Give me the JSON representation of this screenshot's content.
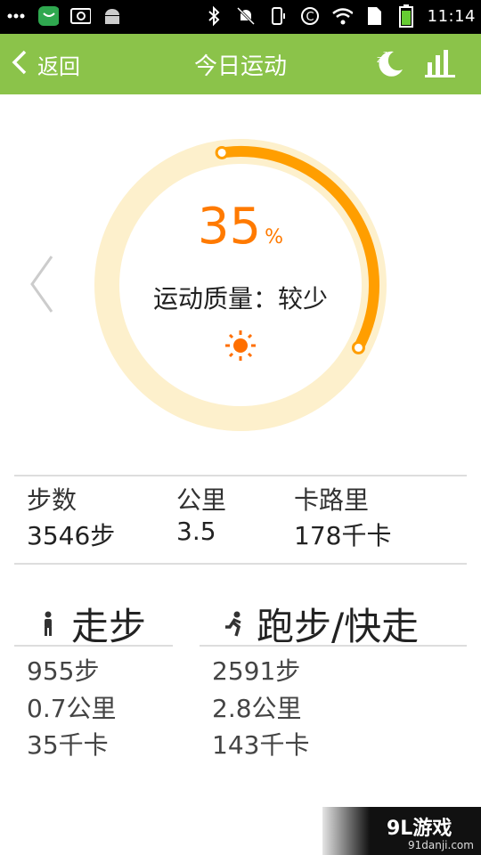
{
  "statusbar": {
    "time": "11:14",
    "left_icons": [
      "overflow-dots-icon",
      "chat-app-icon",
      "screenshot-icon",
      "android-icon"
    ],
    "right_icons": [
      "bluetooth-icon",
      "notifications-off-icon",
      "vibrate-icon",
      "sync-icon",
      "wifi-icon",
      "sim-icon",
      "battery-icon"
    ]
  },
  "appbar": {
    "back_label": "返回",
    "title": "今日运动",
    "actions": [
      "sleep-moon-icon",
      "bar-chart-icon"
    ],
    "background": "#8bc34a"
  },
  "summary": {
    "percent": "35",
    "percent_symbol": "%",
    "progress": 0.35,
    "quality": "运动质量：较少",
    "accent": "#ff9e00",
    "track": "#fdf0cc",
    "weather_icon": "sun-icon"
  },
  "stats": [
    {
      "label": "步数",
      "value": "3546步"
    },
    {
      "label": "公里",
      "value": "3.5"
    },
    {
      "label": "卡路里",
      "value": "178千卡"
    }
  ],
  "walk": {
    "title": "走步",
    "icon": "walking-person-icon",
    "steps": "955步",
    "distance": "0.7公里",
    "calories": "35千卡"
  },
  "run": {
    "title": "跑步/快走",
    "icon": "running-person-icon",
    "steps": "2591步",
    "distance": "2.8公里",
    "calories": "143千卡"
  },
  "watermark": {
    "title": "9L游戏",
    "url": "91danji.com"
  }
}
